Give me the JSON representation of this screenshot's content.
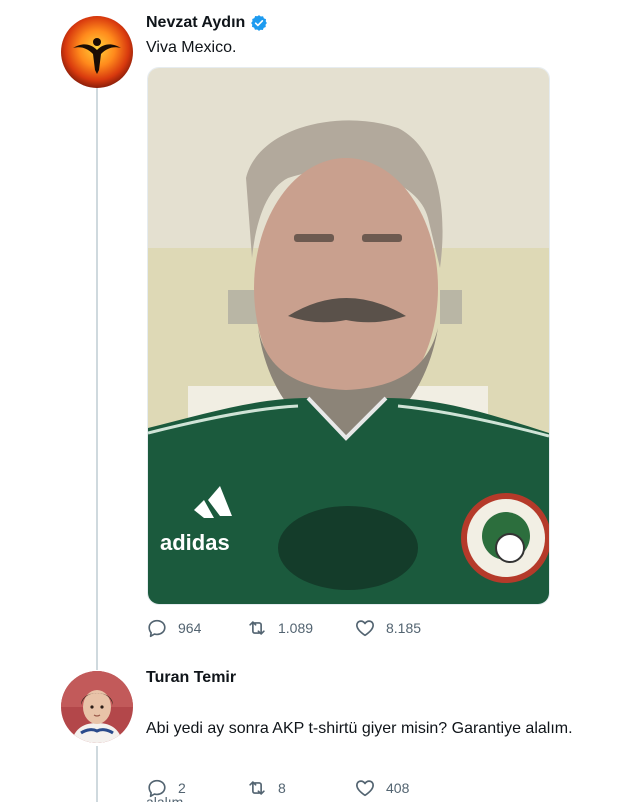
{
  "tweet": {
    "author_name": "Nevzat Aydın",
    "verified": true,
    "text": "Viva Mexico.",
    "media_label": "adidas",
    "stats": {
      "replies": "964",
      "retweets": "1.089",
      "likes": "8.185"
    }
  },
  "reply": {
    "author_name": "Turan Temir",
    "text": "Abi yedi ay sonra AKP t-shirtü giyer misin? Garantiye alalım.",
    "stats": {
      "replies": "2",
      "retweets": "8",
      "likes": "408"
    },
    "cut_text": "alalım"
  },
  "colors": {
    "verified": "#1d9bf0",
    "icon": "#536471",
    "jersey": "#1b5a3d",
    "thread_line": "#cfd9de"
  },
  "icons": {
    "reply": "speech-bubble-icon",
    "retweet": "retweet-icon",
    "like": "heart-icon",
    "verified": "verified-badge-icon"
  }
}
